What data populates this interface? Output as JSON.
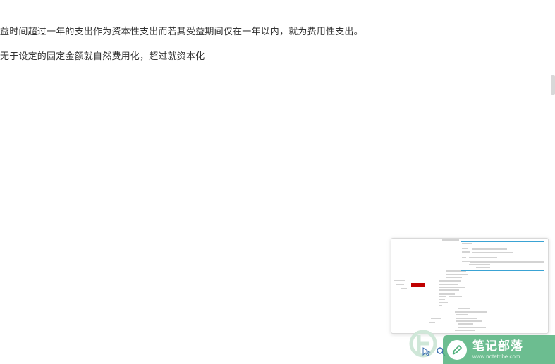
{
  "document": {
    "lines": [
      "益时间超过一年的支出作为资本性支出而若其受益期间仅在一年以内，就为费用性支出。",
      "无于设定的固定金额就自然费用化，超过就资本化"
    ]
  },
  "minimap": {
    "highlight_color": "#c00000",
    "viewport_color": "#3aa3d4"
  },
  "watermark": {
    "title": "笔记部落",
    "url": "www.notetribe.com"
  },
  "icons": {
    "toolbar": [
      "pointer-icon",
      "zoom-icon"
    ]
  }
}
